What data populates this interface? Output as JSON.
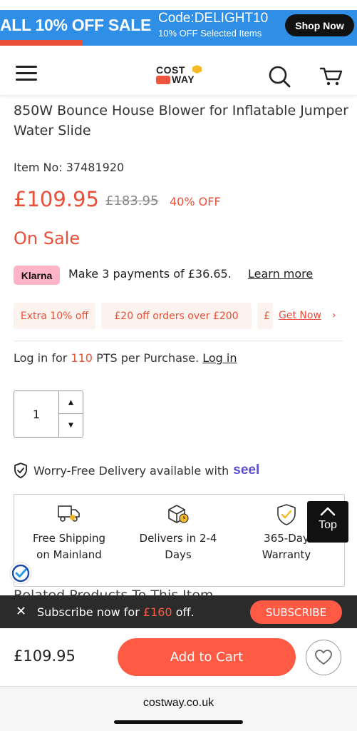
{
  "promo": {
    "headline": "ALL 10% OFF SALE",
    "code": "Code:DELIGHT10",
    "sub": "10% OFF Selected Items",
    "shop_label": "Shop Now",
    "bg_color": "#2f8ee6"
  },
  "header": {
    "logo_top": "COST",
    "logo_bottom": "WAY",
    "icons": [
      "menu-icon",
      "search-icon",
      "cart-icon"
    ]
  },
  "product": {
    "title": "850W Bounce House Blower for Inflatable Jumper Water Slide",
    "item_label": "Item No:",
    "item_no": "37481920",
    "price": "£109.95",
    "old_price": "£183.95",
    "discount": "40% OFF",
    "status": "On Sale",
    "accent_color": "#e8503a"
  },
  "klarna": {
    "badge": "Klarna",
    "text": "Make 3 payments of £36.65.",
    "link": "Learn more"
  },
  "coupons": {
    "items": [
      "Extra 10% off",
      "£20 off orders over £200",
      "£"
    ],
    "get_now": "Get Now",
    "arrow": "›"
  },
  "login": {
    "prefix": "Log in for",
    "points": "110",
    "suffix": "PTS per Purchase.",
    "link": "Log in"
  },
  "quantity": {
    "value": "1",
    "up": "▲",
    "down": "▼"
  },
  "delivery": {
    "text": "Worry-Free Delivery available with",
    "brand": "seel"
  },
  "features": [
    {
      "icon": "truck-icon",
      "label_1": "Free Shipping",
      "label_2": "on Mainland"
    },
    {
      "icon": "package-clock-icon",
      "label_1": "Delivers in 2-4",
      "label_2": "Days"
    },
    {
      "icon": "shield-check-icon",
      "label_1": "365-Day",
      "label_2": "Warranty"
    }
  ],
  "top_button": {
    "arrow": "⌃",
    "label": "Top"
  },
  "related": {
    "heading": "Related Products To This Item"
  },
  "subscribe": {
    "close": "✕",
    "text_prefix": "Subscribe now for",
    "amount": "£160",
    "text_suffix": "off.",
    "button": "SUBSCRIBE"
  },
  "bottom_bar": {
    "price": "£109.95",
    "add_to_cart": "Add to Cart"
  },
  "browser": {
    "url": "costway.co.uk"
  }
}
